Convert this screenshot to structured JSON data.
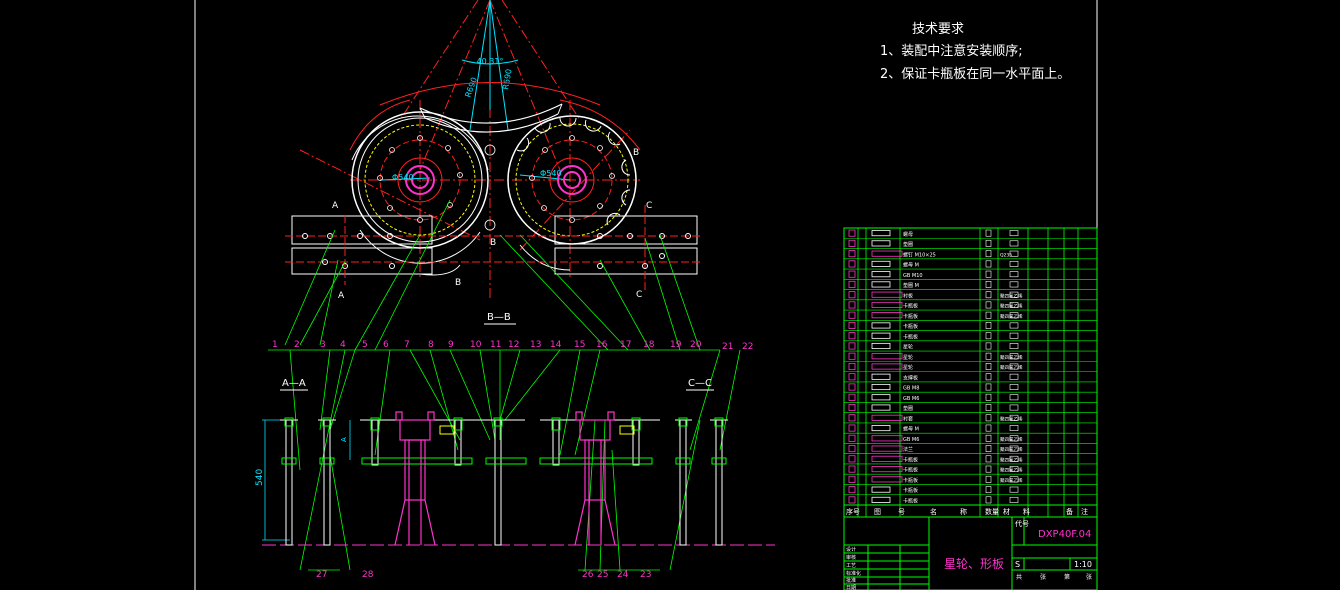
{
  "notes": {
    "title": "技术要求",
    "line1": "1、装配中注意安装顺序;",
    "line2": "2、保证卡瓶板在同一水平面上。"
  },
  "plan_view": {
    "angle_label": "40.31°",
    "radius_labels": [
      "R690",
      "R690"
    ],
    "diameter_labels": [
      "Φ540",
      "Φ540"
    ],
    "section_markers": [
      "A",
      "A",
      "B",
      "B",
      "B",
      "C",
      "C"
    ]
  },
  "section_bb_title": "B—B",
  "section_aa_title": "A—A",
  "section_cc_title": "C—C",
  "height_dim": "540",
  "small_dim": "A",
  "balloons_top": [
    "1",
    "2",
    "3",
    "4",
    "5",
    "6",
    "7",
    "8",
    "9",
    "10",
    "11",
    "12",
    "13",
    "14",
    "15",
    "16",
    "17",
    "18",
    "19",
    "20",
    "21",
    "22"
  ],
  "balloons_bottom": [
    "27",
    "28",
    "26",
    "25",
    "24",
    "23"
  ],
  "title_block": {
    "drawing_no_label": "代号",
    "drawing_no": "DXP40F.04",
    "name": "星轮、形板",
    "scale": "1:10",
    "stage": "S",
    "header_cols": [
      "序号",
      "图",
      "号",
      "名",
      "称",
      "数量",
      "材",
      "料",
      "备",
      "注"
    ],
    "side_labels": [
      "设计",
      "审核",
      "工艺",
      "标准化",
      "批准",
      "日期"
    ],
    "footer": [
      "共",
      "张",
      "第",
      "张"
    ]
  },
  "bom_rows": [
    {
      "name": "螺母",
      "mat": ""
    },
    {
      "name": "垫圈",
      "mat": ""
    },
    {
      "name": "螺钉 M10×25",
      "mat": "Q235"
    },
    {
      "name": "螺母 M",
      "mat": ""
    },
    {
      "name": "GB M10",
      "mat": ""
    },
    {
      "name": "垫圈 M",
      "mat": ""
    },
    {
      "name": "衬板",
      "mat": "聚四氟乙烯"
    },
    {
      "name": "卡瓶板",
      "mat": "聚四氟乙烯"
    },
    {
      "name": "卡瓶板",
      "mat": "聚四氟乙烯"
    },
    {
      "name": "卡瓶板",
      "mat": ""
    },
    {
      "name": "卡瓶板",
      "mat": ""
    },
    {
      "name": "星轮",
      "mat": ""
    },
    {
      "name": "星轮",
      "mat": "聚四氟乙烯"
    },
    {
      "name": "星轮",
      "mat": "聚四氟乙烯"
    },
    {
      "name": "支撑板",
      "mat": ""
    },
    {
      "name": "GB M8",
      "mat": ""
    },
    {
      "name": "GB M6",
      "mat": ""
    },
    {
      "name": "垫圈",
      "mat": ""
    },
    {
      "name": "衬套",
      "mat": "聚四氟乙烯"
    },
    {
      "name": "螺母 M",
      "mat": ""
    },
    {
      "name": "GB M6",
      "mat": "聚四氟乙烯"
    },
    {
      "name": "法兰",
      "mat": "聚四氟乙烯"
    },
    {
      "name": "卡瓶板",
      "mat": "聚四氟乙烯"
    },
    {
      "name": "卡瓶板",
      "mat": "聚四氟乙烯"
    },
    {
      "name": "卡瓶板",
      "mat": "聚四氟乙烯"
    },
    {
      "name": "卡瓶板",
      "mat": ""
    },
    {
      "name": "卡瓶板",
      "mat": ""
    }
  ]
}
